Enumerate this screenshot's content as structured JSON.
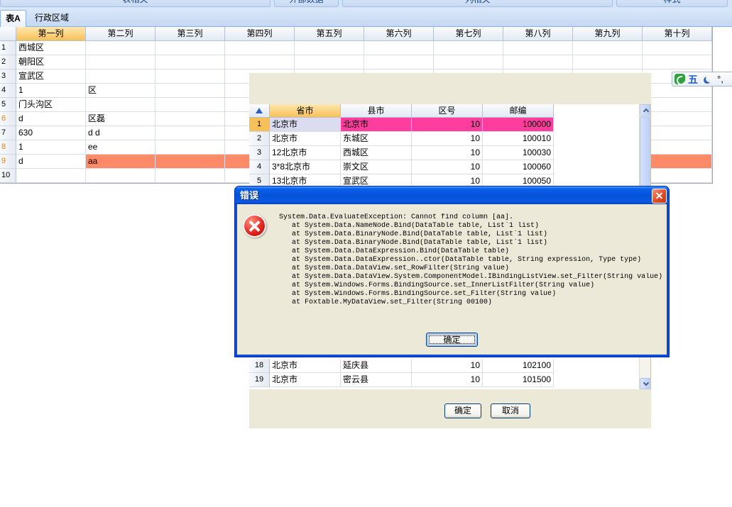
{
  "toolbar": {
    "groups": [
      "表相关",
      "外部数据",
      "列相关",
      "样式"
    ]
  },
  "tabs": [
    {
      "label": "表A",
      "active": true
    },
    {
      "label": "行政区域",
      "active": false
    }
  ],
  "main_grid": {
    "columns": [
      {
        "label": "第一列",
        "active": true
      },
      {
        "label": "第二列",
        "active": false
      },
      {
        "label": "第三列",
        "active": false
      },
      {
        "label": "第四列",
        "active": false
      },
      {
        "label": "第五列",
        "active": false
      },
      {
        "label": "第六列",
        "active": false
      },
      {
        "label": "第七列",
        "active": false
      },
      {
        "label": "第八列",
        "active": false
      },
      {
        "label": "第九列",
        "active": false
      },
      {
        "label": "第十列",
        "active": false
      }
    ],
    "rows": [
      {
        "num": "1",
        "cells": [
          "西城区"
        ]
      },
      {
        "num": "2",
        "cells": [
          "朝阳区"
        ]
      },
      {
        "num": "3",
        "cells": [
          "宣武区"
        ]
      },
      {
        "num": "4",
        "cells": [
          "1",
          "区"
        ]
      },
      {
        "num": "5",
        "cells": [
          "门头沟区"
        ]
      },
      {
        "num": "6",
        "cells": [
          "d",
          "区磊"
        ],
        "number_highlight": true
      },
      {
        "num": "7",
        "cells": [
          "630",
          "d d"
        ]
      },
      {
        "num": "8",
        "cells": [
          "1",
          "ee"
        ],
        "number_highlight": true
      },
      {
        "num": "9",
        "cells": [
          "d",
          "aa"
        ],
        "number_highlight": true,
        "selected": true
      },
      {
        "num": "10",
        "cells": []
      }
    ]
  },
  "ime": {
    "logo_icon": "sogou-logo-icon",
    "mode_label": "五",
    "width_icon": "moon-icon",
    "punct_label": "°,"
  },
  "lookup_dialog": {
    "corner_icon": "sort-icon",
    "columns": [
      {
        "label": "省市",
        "active": true
      },
      {
        "label": "县市",
        "active": false
      },
      {
        "label": "区号",
        "active": false
      },
      {
        "label": "邮编",
        "active": false
      }
    ],
    "rows": [
      {
        "num": "1",
        "cells": [
          "北京市",
          "北京市",
          "10",
          "100000"
        ],
        "current": true
      },
      {
        "num": "2",
        "cells": [
          "北京市",
          "东城区",
          "10",
          "100010"
        ]
      },
      {
        "num": "3",
        "cells": [
          "12北京市",
          "西城区",
          "10",
          "100030"
        ]
      },
      {
        "num": "4",
        "cells": [
          "3*8北京市",
          "崇文区",
          "10",
          "100060"
        ]
      },
      {
        "num": "5",
        "cells": [
          "13北京市",
          "宣武区",
          "10",
          "100050"
        ]
      },
      {
        "num": "18",
        "cells": [
          "北京市",
          "延庆县",
          "10",
          "102100"
        ]
      },
      {
        "num": "19",
        "cells": [
          "北京市",
          "密云县",
          "10",
          "101500"
        ]
      }
    ],
    "ok_label": "确定",
    "cancel_label": "取消"
  },
  "error_dialog": {
    "title": "错误",
    "icon": "error-icon",
    "close_icon": "close-icon",
    "message_lines": [
      "System.Data.EvaluateException: Cannot find column [aa].",
      "   at System.Data.NameNode.Bind(DataTable table, List`1 list)",
      "   at System.Data.BinaryNode.Bind(DataTable table, List`1 list)",
      "   at System.Data.BinaryNode.Bind(DataTable table, List`1 list)",
      "   at System.Data.DataExpression.Bind(DataTable table)",
      "   at System.Data.DataExpression..ctor(DataTable table, String expression, Type type)",
      "   at System.Data.DataView.set_RowFilter(String value)",
      "   at System.Data.DataView.System.ComponentModel.IBindingListView.set_Filter(String value)",
      "   at System.Windows.Forms.BindingSource.set_InnerListFilter(String value)",
      "   at System.Windows.Forms.BindingSource.set_Filter(String value)",
      "   at Foxtable.MyDataView.set_Filter(String 00100)"
    ],
    "ok_label": "确定"
  },
  "colors": {
    "header_active": "#f8c058",
    "selected_row": "#fe8a68",
    "row_number_highlight": "#e8860c",
    "lookup_current_row": "#ff3d9e",
    "lookup_current_cell": "#dcdcf0",
    "dialog_bg": "#ece9d8",
    "titlebar": "#0553d8"
  }
}
